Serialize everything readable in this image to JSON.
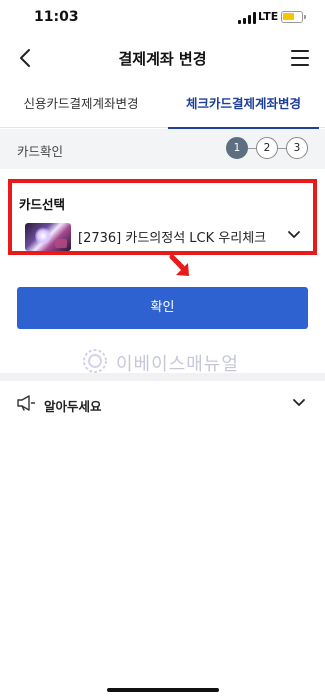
{
  "status_bar": {
    "time": "11:03",
    "network": "LTE",
    "battery_level_fraction": 0.5,
    "battery_color": "#f6c700"
  },
  "header": {
    "title": "결제계좌 변경",
    "back_icon": "chevron-left-icon",
    "menu_icon": "hamburger-menu-icon"
  },
  "tabs": [
    {
      "label": "신용카드결제계좌변경",
      "active": false
    },
    {
      "label": "체크카드결제계좌변경",
      "active": true
    }
  ],
  "steps": {
    "label": "카드확인",
    "items": [
      "1",
      "2",
      "3"
    ],
    "current": 1
  },
  "card_select": {
    "title": "카드선택",
    "selected": "[2736] 카드의정석 LCK 우리체크",
    "highlight_color": "#e81a1a"
  },
  "confirm": {
    "label": "확인",
    "color": "#2f62d1"
  },
  "watermark": {
    "text": "이베이스매뉴얼"
  },
  "notice": {
    "label": "알아두세요",
    "icon": "speaker-icon"
  },
  "colors": {
    "accent": "#1e3f9a",
    "step_active": "#5d6f80"
  }
}
